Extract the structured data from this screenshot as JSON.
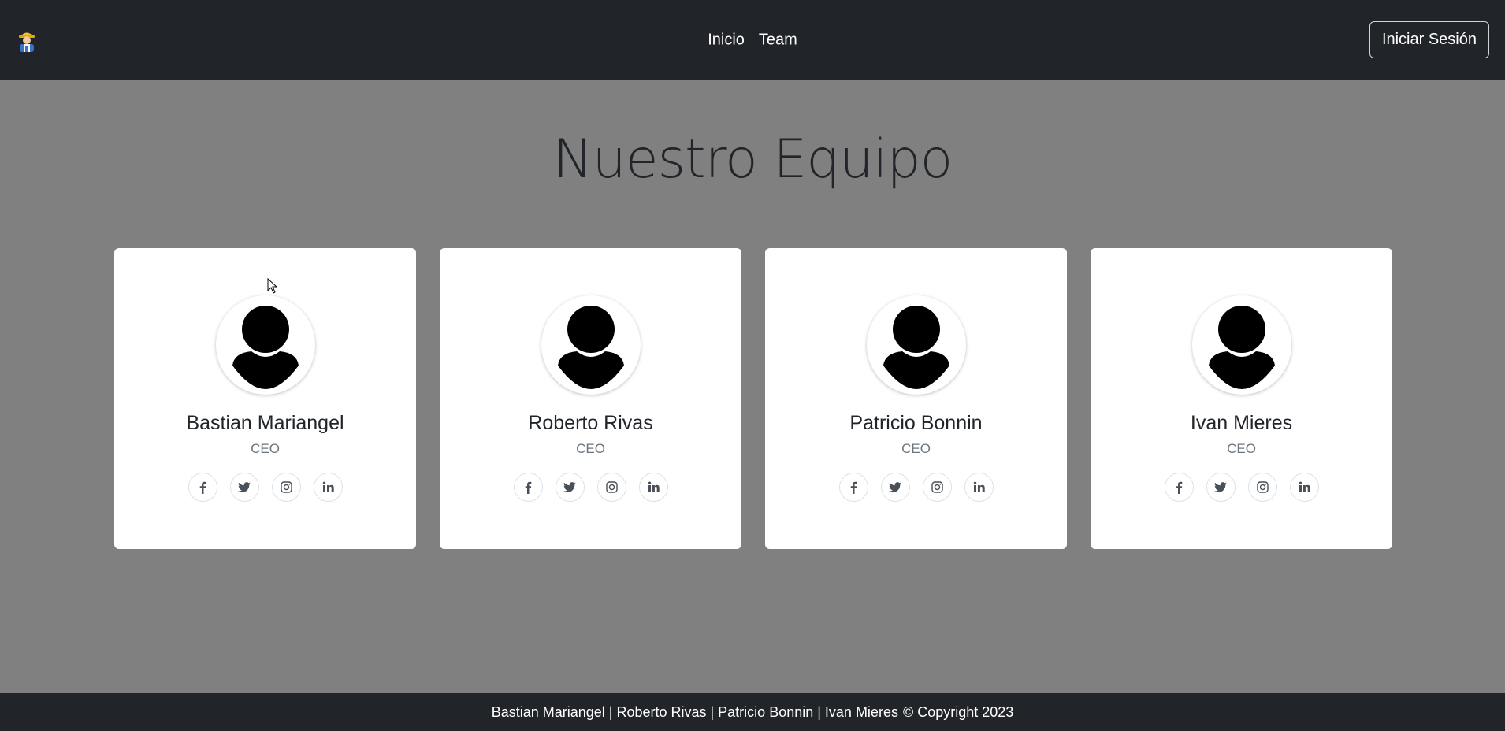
{
  "navbar": {
    "brand_icon": "construction-worker-icon",
    "links": [
      "Inicio",
      "Team"
    ],
    "login_label": "Iniciar Sesión"
  },
  "page": {
    "title": "Nuestro Equipo"
  },
  "team": [
    {
      "name": "Bastian Mariangel",
      "role": "CEO"
    },
    {
      "name": "Roberto Rivas",
      "role": "CEO"
    },
    {
      "name": "Patricio Bonnin",
      "role": "CEO"
    },
    {
      "name": "Ivan Mieres",
      "role": "CEO"
    }
  ],
  "social_icons": [
    "facebook-icon",
    "twitter-icon",
    "instagram-icon",
    "linkedin-icon"
  ],
  "footer": {
    "names": "Bastian Mariangel | Roberto Rivas | Patricio Bonnin | Ivan Mieres",
    "copyright": "© Copyright 2023"
  },
  "colors": {
    "navbar_bg": "#212529",
    "page_bg": "#808080",
    "card_bg": "#ffffff"
  }
}
